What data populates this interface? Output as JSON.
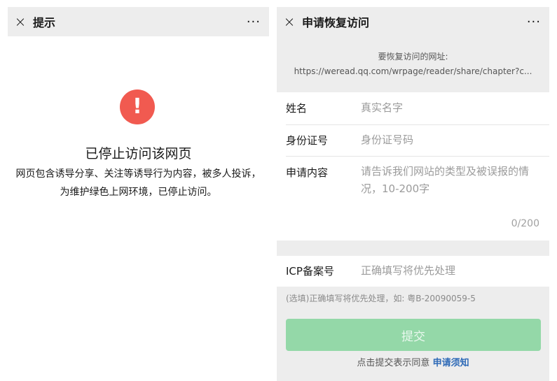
{
  "left_screen": {
    "header": {
      "close_icon": "×",
      "title": "提示",
      "more": "···"
    },
    "alert_icon": "!",
    "status_title": "已停止访问该网页",
    "description": "网页包含诱导分享、关注等诱导行为内容，被多人投诉，为维护绿色上网环境，已停止访问。"
  },
  "right_screen": {
    "header": {
      "close_icon": "×",
      "title": "申请恢复访问",
      "more": "···"
    },
    "url_label": "要恢复访问的网址:",
    "url_value": "https://weread.qq.com/wrpage/reader/share/chapter?c...",
    "form": {
      "name_label": "姓名",
      "name_placeholder": "真实名字",
      "id_label": "身份证号",
      "id_placeholder": "身份证号码",
      "content_label": "申请内容",
      "content_placeholder": "请告诉我们网站的类型及被误报的情况，10-200字",
      "counter": "0/200",
      "icp_label": "ICP备案号",
      "icp_placeholder": "正确填写将优先处理",
      "icp_hint": "(选填)正确填写将优先处理，如: 粤B-20090059-5"
    },
    "submit_label": "提交",
    "agree_text": "点击提交表示同意",
    "agree_link": "申请须知"
  },
  "colors": {
    "alert_red": "#f15a50",
    "submit_green_disabled": "#94d8a8",
    "link_blue": "#2e6ab7",
    "header_gray": "#ededed"
  }
}
